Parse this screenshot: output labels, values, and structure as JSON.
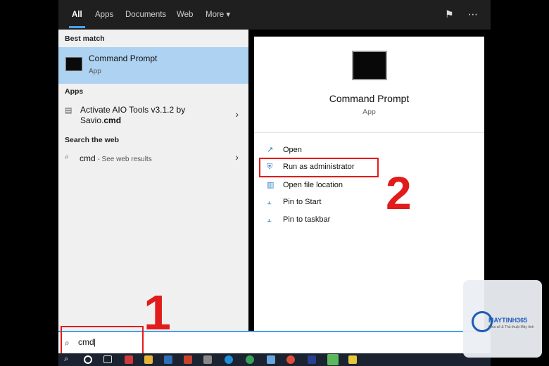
{
  "tabs": [
    {
      "label": "All"
    },
    {
      "label": "Apps"
    },
    {
      "label": "Documents"
    },
    {
      "label": "Web"
    },
    {
      "label": "More ▾"
    }
  ],
  "left": {
    "best_match_header": "Best match",
    "best_match": {
      "title": "Command Prompt",
      "subtitle": "App"
    },
    "apps_header": "Apps",
    "app_item": {
      "line1": "Activate AIO Tools v3.1.2 by",
      "line2_prefix": "Savio.",
      "line2_bold": "cmd"
    },
    "web_header": "Search the web",
    "web_item": {
      "query": "cmd",
      "hint": " - See web results"
    }
  },
  "right": {
    "title": "Command Prompt",
    "subtitle": "App",
    "actions": [
      {
        "label": "Open",
        "icon": "open-icon"
      },
      {
        "label": "Run as administrator",
        "icon": "shield-icon"
      },
      {
        "label": "Open file location",
        "icon": "file-location-icon"
      },
      {
        "label": "Pin to Start",
        "icon": "pin-icon"
      },
      {
        "label": "Pin to taskbar",
        "icon": "pin-icon"
      }
    ]
  },
  "search": {
    "value": "cmd"
  },
  "annotations": {
    "step1": "1",
    "step2": "2",
    "color": "#e21b1b"
  },
  "watermark": {
    "brand": "MAYTINH365",
    "tagline": "Chia sẻ & Thủ thuật Máy tính"
  },
  "colors": {
    "accent": "#4aa0e6",
    "selection": "#aed2f1"
  }
}
